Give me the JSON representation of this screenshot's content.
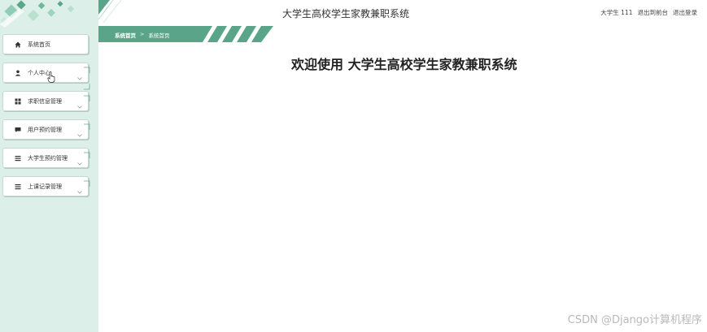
{
  "header": {
    "title": "大学生高校学生家教兼职系统",
    "user_label": "大学生 111",
    "to_frontend": "退出到前台",
    "logout": "退出登录"
  },
  "breadcrumb": {
    "root": "系统首页",
    "separator": ">",
    "current": "系统首页"
  },
  "sidebar": {
    "items": [
      {
        "label": "系统首页",
        "icon": "home-icon",
        "has_chevron": false
      },
      {
        "label": "个人中心",
        "icon": "person-icon",
        "has_chevron": true
      },
      {
        "label": "求职信息管理",
        "icon": "grid-icon",
        "has_chevron": true
      },
      {
        "label": "用户预约管理",
        "icon": "chat-icon",
        "has_chevron": true
      },
      {
        "label": "大学生预约管理",
        "icon": "list-icon",
        "has_chevron": true
      },
      {
        "label": "上课记录管理",
        "icon": "list-icon",
        "has_chevron": true
      }
    ]
  },
  "main": {
    "welcome": "欢迎使用 大学生高校学生家教兼职系统"
  },
  "watermark": "CSDN @Django计算机程序",
  "colors": {
    "accent": "#5aa58a",
    "sidebar_bg": "#dcefe8",
    "deco_light": "#9fd3bf"
  }
}
